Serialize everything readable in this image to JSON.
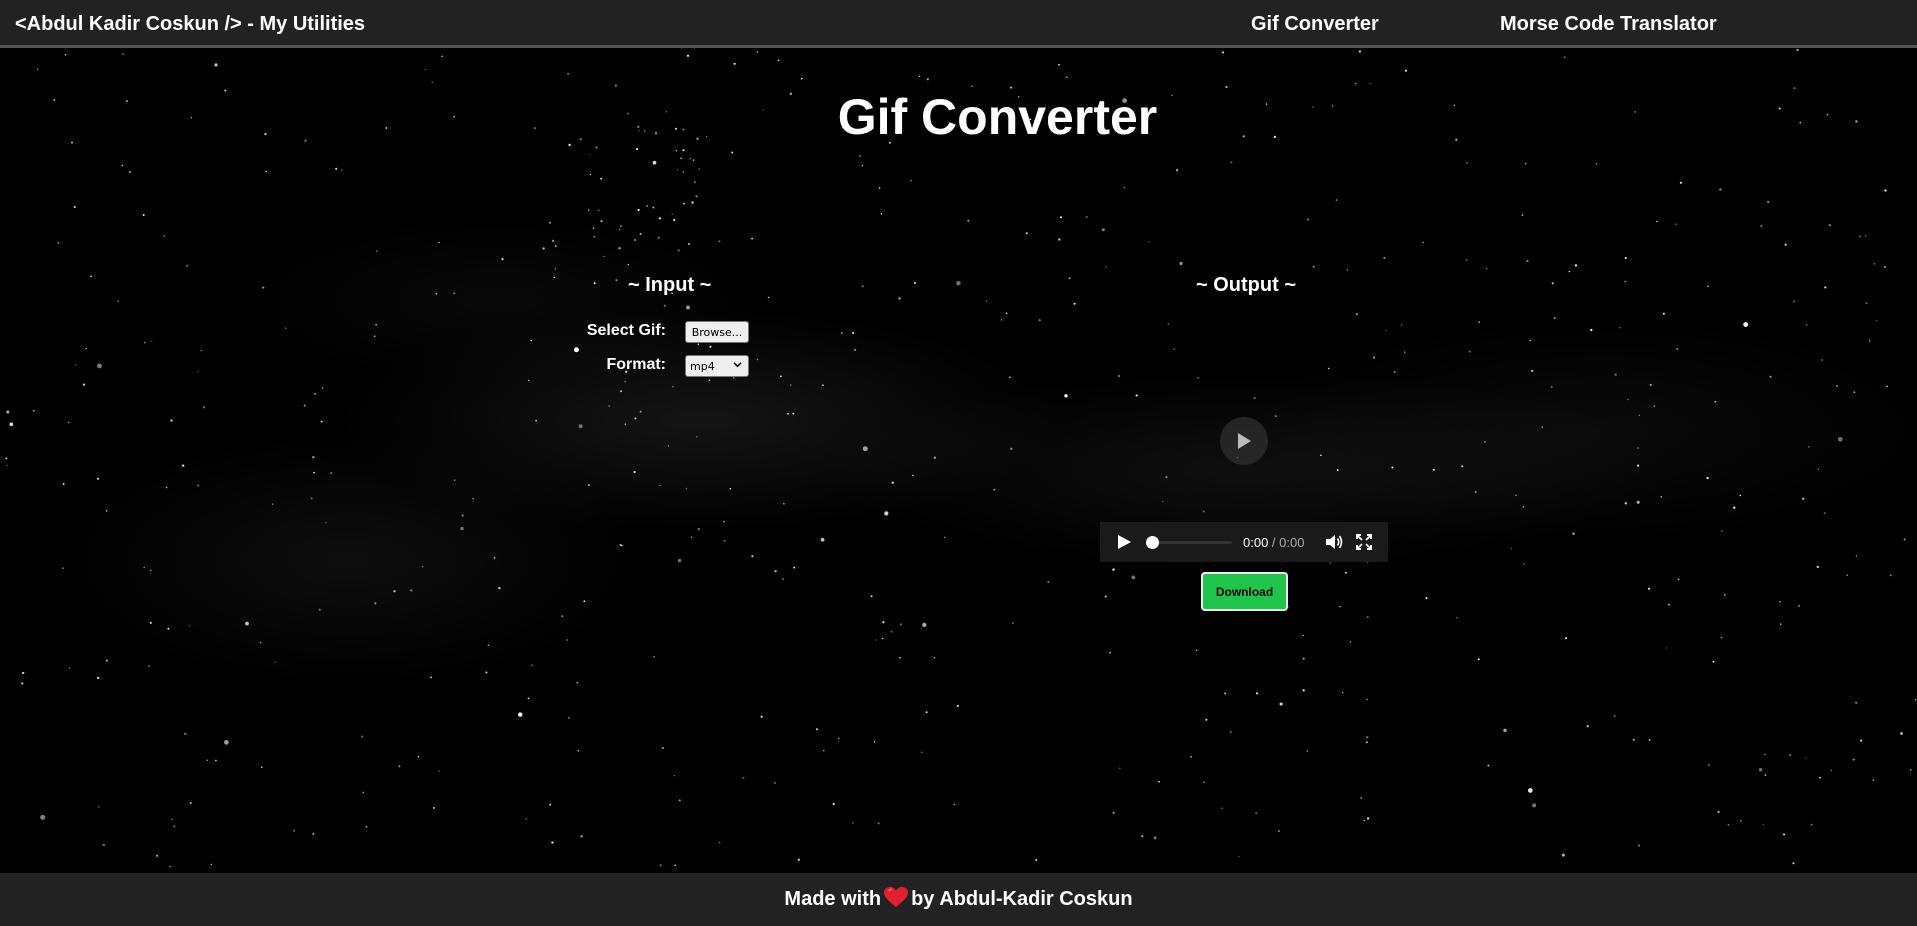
{
  "nav": {
    "brand": "<Abdul Kadir Coskun /> - My Utilities",
    "links": [
      {
        "label": "Gif Converter"
      },
      {
        "label": "Morse Code Translator"
      }
    ]
  },
  "page": {
    "title": "Gif Converter"
  },
  "input": {
    "title": "~ Input ~",
    "select_gif_label": "Select Gif:",
    "browse_label": "Browse...",
    "format_label": "Format:",
    "format_value": "mp4"
  },
  "output": {
    "title": "~ Output ~",
    "video": {
      "current_time": "0:00",
      "separator": " / ",
      "duration": "0:00"
    },
    "download_label": "Download"
  },
  "footer": {
    "prefix": "Made with",
    "suffix": "by Abdul-Kadir Coskun"
  },
  "colors": {
    "navbar_bg": "#222222",
    "download_bg": "#1fc44a",
    "heart": "#e0202e"
  }
}
